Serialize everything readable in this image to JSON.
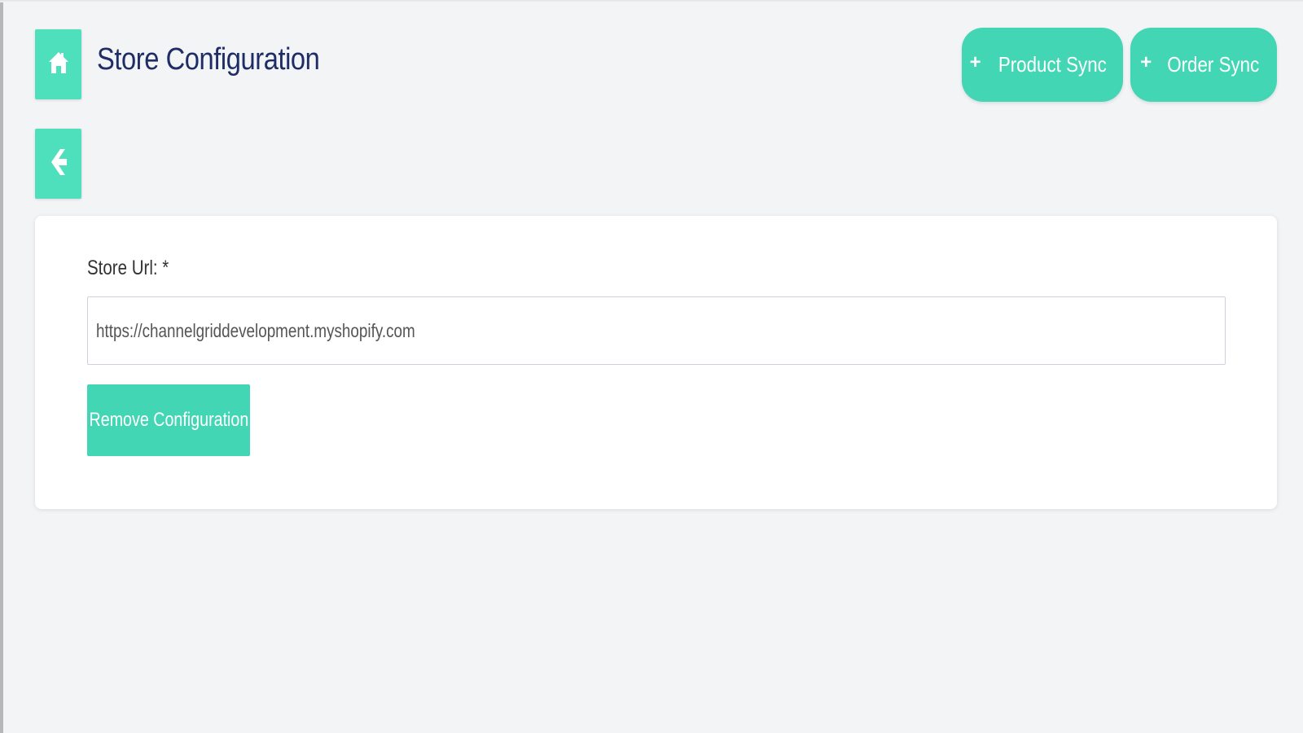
{
  "header": {
    "title": "Store Configuration",
    "home_icon": "home-icon",
    "back_icon": "arrow-left-icon"
  },
  "actions": {
    "product_sync_label": "Product Sync",
    "order_sync_label": "Order Sync",
    "plus_icon": "+"
  },
  "form": {
    "store_url_label": "Store Url: *",
    "store_url_value": "https://channelgriddevelopment.myshopify.com",
    "remove_button_label": "Remove Configuration"
  },
  "colors": {
    "accent": "#42d6b4",
    "tile": "#4ee0bc",
    "title": "#1f2d66",
    "background": "#f3f4f6"
  }
}
